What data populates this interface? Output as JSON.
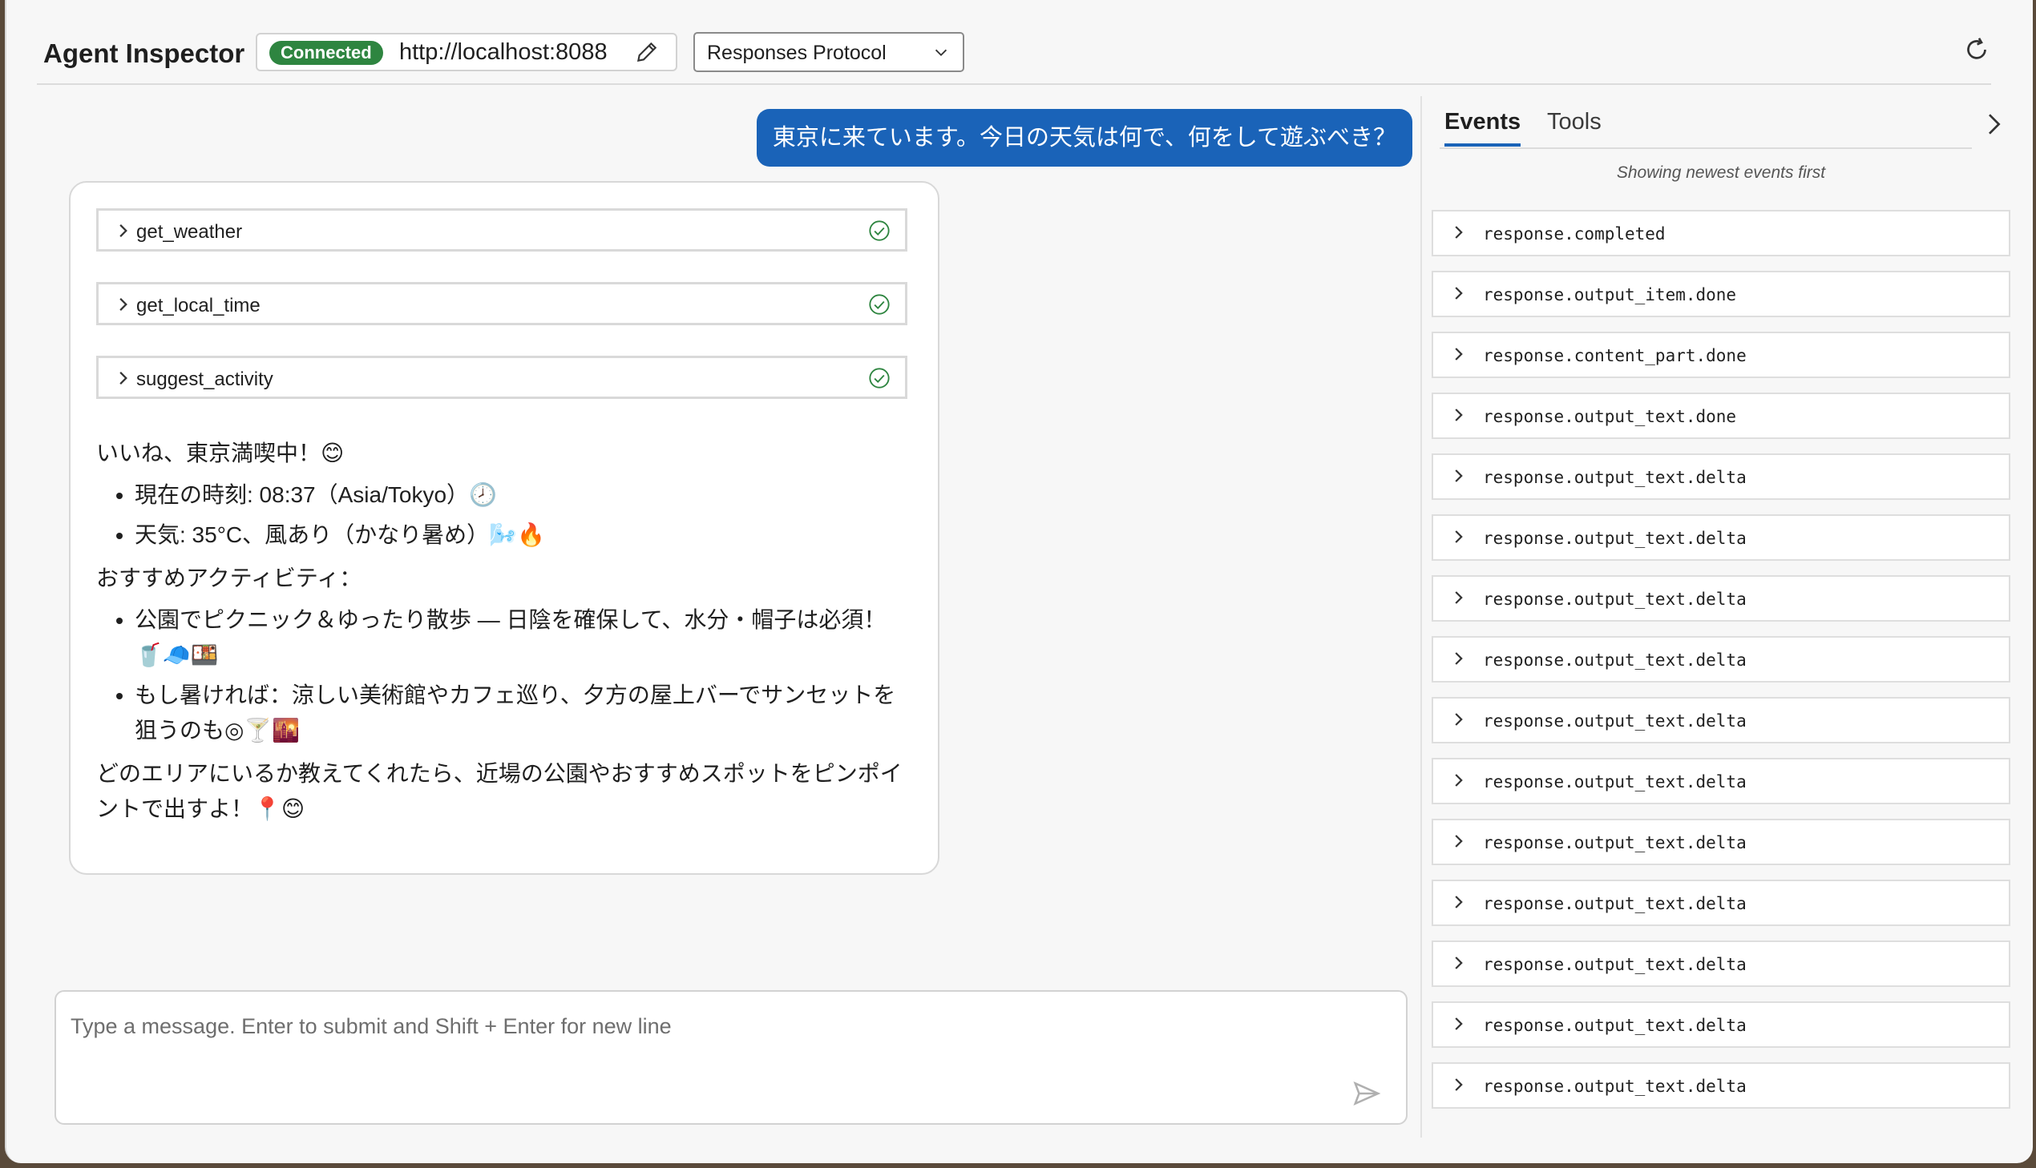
{
  "header": {
    "title": "Agent Inspector",
    "status_badge": "Connected",
    "url": "http://localhost:8088",
    "protocol": "Responses Protocol"
  },
  "chat": {
    "user_message": "東京に来ています。今日の天気は何で、何をして遊ぶべき？",
    "tool_calls": [
      "get_weather",
      "get_local_time",
      "suggest_activity"
    ],
    "answer": {
      "intro": "いいね、東京満喫中！😊",
      "facts": [
        "現在の時刻: 08:37（Asia/Tokyo）🕗",
        "天気: 35°C、風あり（かなり暑め）🌬️🔥"
      ],
      "activities_heading": "おすすめアクティビティ：",
      "activities": [
        "公園でピクニック＆ゆったり散歩 — 日陰を確保して、水分・帽子は必須！🥤🧢🍱",
        "もし暑ければ：涼しい美術館やカフェ巡り、夕方の屋上バーでサンセットを狙うのも◎🍸🌇"
      ],
      "closing": "どのエリアにいるか教えてくれたら、近場の公園やおすすめスポットをピンポイントで出すよ！📍😊"
    },
    "composer_placeholder": "Type a message. Enter to submit and Shift + Enter for new line"
  },
  "side_panel": {
    "tabs": [
      "Events",
      "Tools"
    ],
    "active_tab": "Events",
    "note": "Showing newest events first",
    "events": [
      "response.completed",
      "response.output_item.done",
      "response.content_part.done",
      "response.output_text.done",
      "response.output_text.delta",
      "response.output_text.delta",
      "response.output_text.delta",
      "response.output_text.delta",
      "response.output_text.delta",
      "response.output_text.delta",
      "response.output_text.delta",
      "response.output_text.delta",
      "response.output_text.delta",
      "response.output_text.delta",
      "response.output_text.delta"
    ]
  },
  "colors": {
    "accent": "#1a63b8",
    "connected": "#2e8540"
  },
  "icons": [
    "edit-icon",
    "chevron-down-icon",
    "refresh-icon",
    "chevron-right-icon",
    "check-circle-icon",
    "send-icon"
  ]
}
